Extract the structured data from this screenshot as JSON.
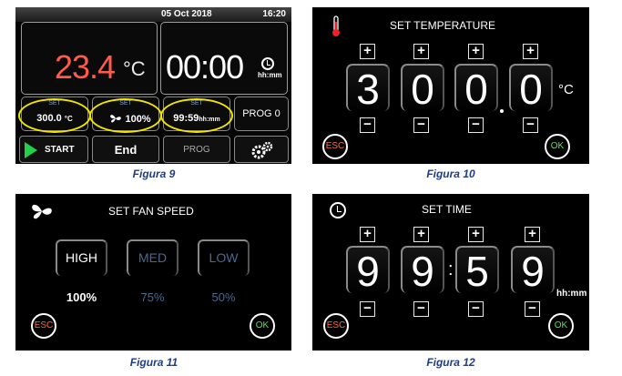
{
  "fig9": {
    "date": "05 Oct 2018",
    "clock": "16:20",
    "temperature": "23.4",
    "temperature_unit": "°C",
    "timer": "00:00",
    "timer_unit": "hh:mm",
    "set_label": "SET",
    "set_temp": "300.0",
    "set_temp_unit": "°C",
    "set_fan": "100%",
    "set_time": "99:59",
    "set_time_unit": "hh:mm",
    "prog_label": "PROG 0",
    "start_label": "START",
    "end_label": "End",
    "prog_button": "PROG",
    "caption": "Figura 9",
    "highlight_color": "#f2e600",
    "temp_color": "#ff5a4a"
  },
  "fig10": {
    "title": "SET TEMPERATURE",
    "digits": [
      "3",
      "0",
      "0",
      "0"
    ],
    "unit": "°C",
    "plus": "+",
    "minus": "−",
    "esc": "ESC",
    "ok": "OK",
    "caption": "Figura 10"
  },
  "fig11": {
    "title": "SET FAN SPEED",
    "options": [
      {
        "label": "HIGH",
        "percent": "100%"
      },
      {
        "label": "MED",
        "percent": "75%"
      },
      {
        "label": "LOW",
        "percent": "50%"
      }
    ],
    "esc": "ESC",
    "ok": "OK",
    "caption": "Figura 11"
  },
  "fig12": {
    "title": "SET TIME",
    "digits": [
      "9",
      "9",
      "5",
      "9"
    ],
    "separator": ":",
    "unit": "hh:mm",
    "plus": "+",
    "minus": "−",
    "esc": "ESC",
    "ok": "OK",
    "caption": "Figura 12"
  }
}
